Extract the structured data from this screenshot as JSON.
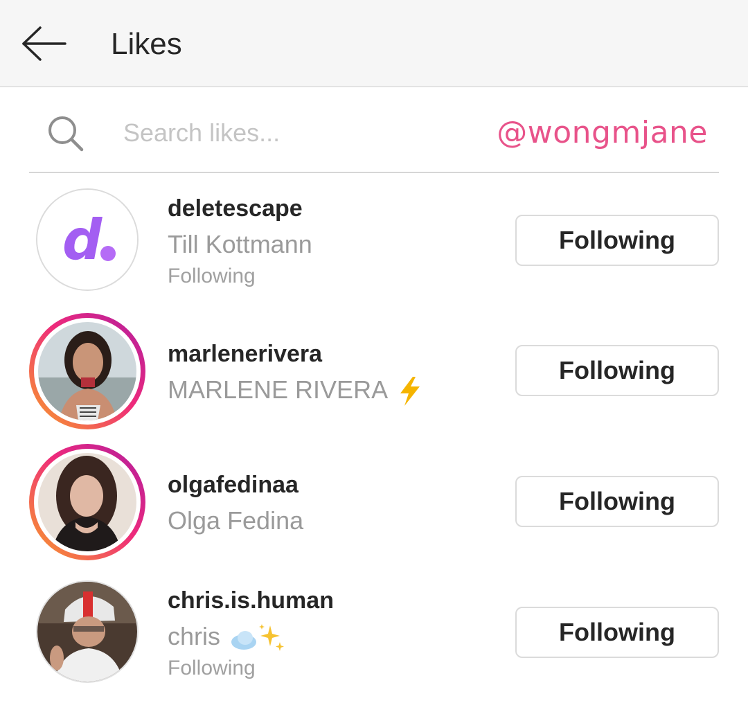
{
  "header": {
    "title": "Likes",
    "back_icon": "arrow-left-icon"
  },
  "search": {
    "placeholder": "Search likes...",
    "value": "",
    "icon": "search-icon"
  },
  "watermark": "@wongmjane",
  "users": [
    {
      "username": "deletescape",
      "full_name": "Till Kottmann",
      "status": "Following",
      "button": "Following",
      "has_story": false,
      "avatar": "d-logo"
    },
    {
      "username": "marlenerivera",
      "full_name": "MARLENE RIVERA",
      "status": "",
      "button": "Following",
      "has_story": true,
      "avatar": "photo",
      "emoji": "lightning-icon"
    },
    {
      "username": "olgafedinaa",
      "full_name": "Olga Fedina",
      "status": "",
      "button": "Following",
      "has_story": true,
      "avatar": "photo"
    },
    {
      "username": "chris.is.human",
      "full_name": "chris",
      "status": "Following",
      "button": "Following",
      "has_story": false,
      "avatar": "photo",
      "emoji": "cloud-sparkles-icon"
    }
  ],
  "colors": {
    "accent": "#e8538a",
    "ring_start": "#f8a128",
    "ring_end": "#b01ea0",
    "secondary_text": "#9a9a9a"
  }
}
